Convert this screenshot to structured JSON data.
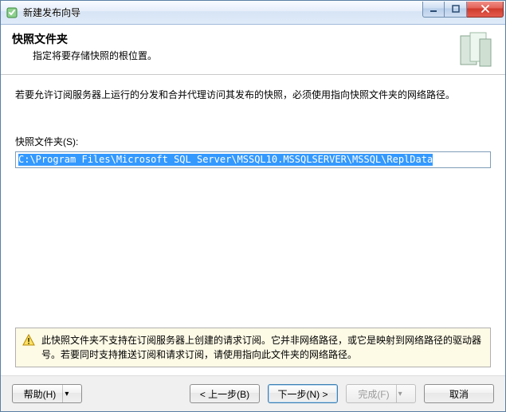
{
  "window": {
    "title": "新建发布向导"
  },
  "header": {
    "title": "快照文件夹",
    "subtitle": "指定将要存储快照的根位置。"
  },
  "content": {
    "instruction": "若要允许订阅服务器上运行的分发和合并代理访问其发布的快照，必须使用指向快照文件夹的网络路径。",
    "field_label": "快照文件夹(S):",
    "path_value": "C:\\Program Files\\Microsoft SQL Server\\MSSQL10.MSSQLSERVER\\MSSQL\\ReplData"
  },
  "warning": {
    "text": "此快照文件夹不支持在订阅服务器上创建的请求订阅。它并非网络路径，或它是映射到网络路径的驱动器号。若要同时支持推送订阅和请求订阅，请使用指向此文件夹的网络路径。"
  },
  "buttons": {
    "help": "帮助(H)",
    "back": "< 上一步(B)",
    "next": "下一步(N) >",
    "finish": "完成(F)",
    "cancel": "取消"
  },
  "icons": {
    "app": "wizard-icon",
    "warn": "warning-icon"
  }
}
